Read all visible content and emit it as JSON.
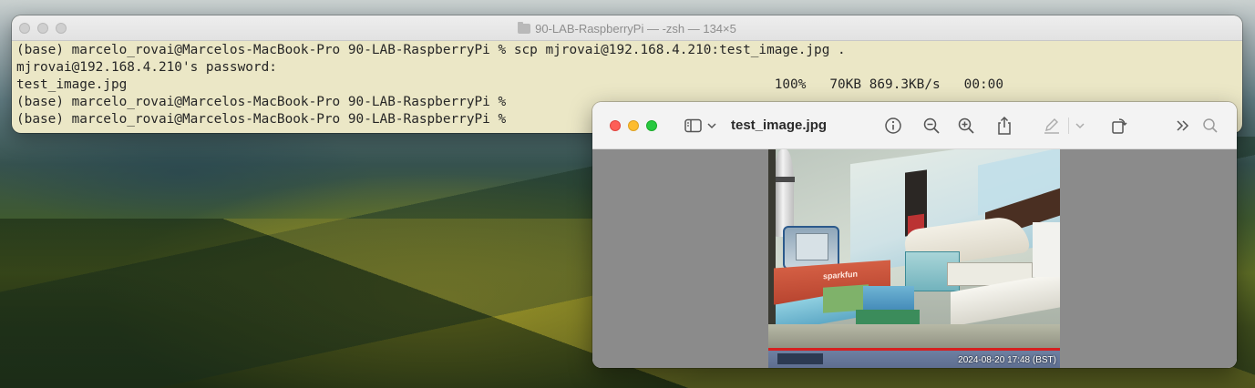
{
  "terminal": {
    "title": "90-LAB-RaspberryPi — -zsh — 134×5",
    "lines": [
      "(base) marcelo_rovai@Marcelos-MacBook-Pro 90-LAB-RaspberryPi % scp mjrovai@192.168.4.210:test_image.jpg .",
      "mjrovai@192.168.4.210's password:",
      "test_image.jpg                                                                                  100%   70KB 869.3KB/s   00:00",
      "(base) marcelo_rovai@Marcelos-MacBook-Pro 90-LAB-RaspberryPi %",
      "(base) marcelo_rovai@Marcelos-MacBook-Pro 90-LAB-RaspberryPi %"
    ]
  },
  "preview": {
    "title": "test_image.jpg",
    "toolbar": {
      "sidebar_icon": "sidebar-icon",
      "info_icon": "info-icon",
      "zoom_out_icon": "zoom-out-icon",
      "zoom_in_icon": "zoom-in-icon",
      "share_icon": "share-icon",
      "markup_icon": "pen-icon",
      "rotate_icon": "rotate-icon",
      "more_icon": "chevron-double-right-icon",
      "search_icon": "search-icon"
    },
    "image": {
      "timestamp": "2024-08-20 17:48 (BST)",
      "box_label": "sparkfun"
    }
  },
  "colors": {
    "terminal_bg": "#ebe7c6",
    "close": "#fe5f57",
    "minimize": "#febc2e",
    "maximize": "#28c840",
    "preview_canvas": "#8b8b8b"
  }
}
